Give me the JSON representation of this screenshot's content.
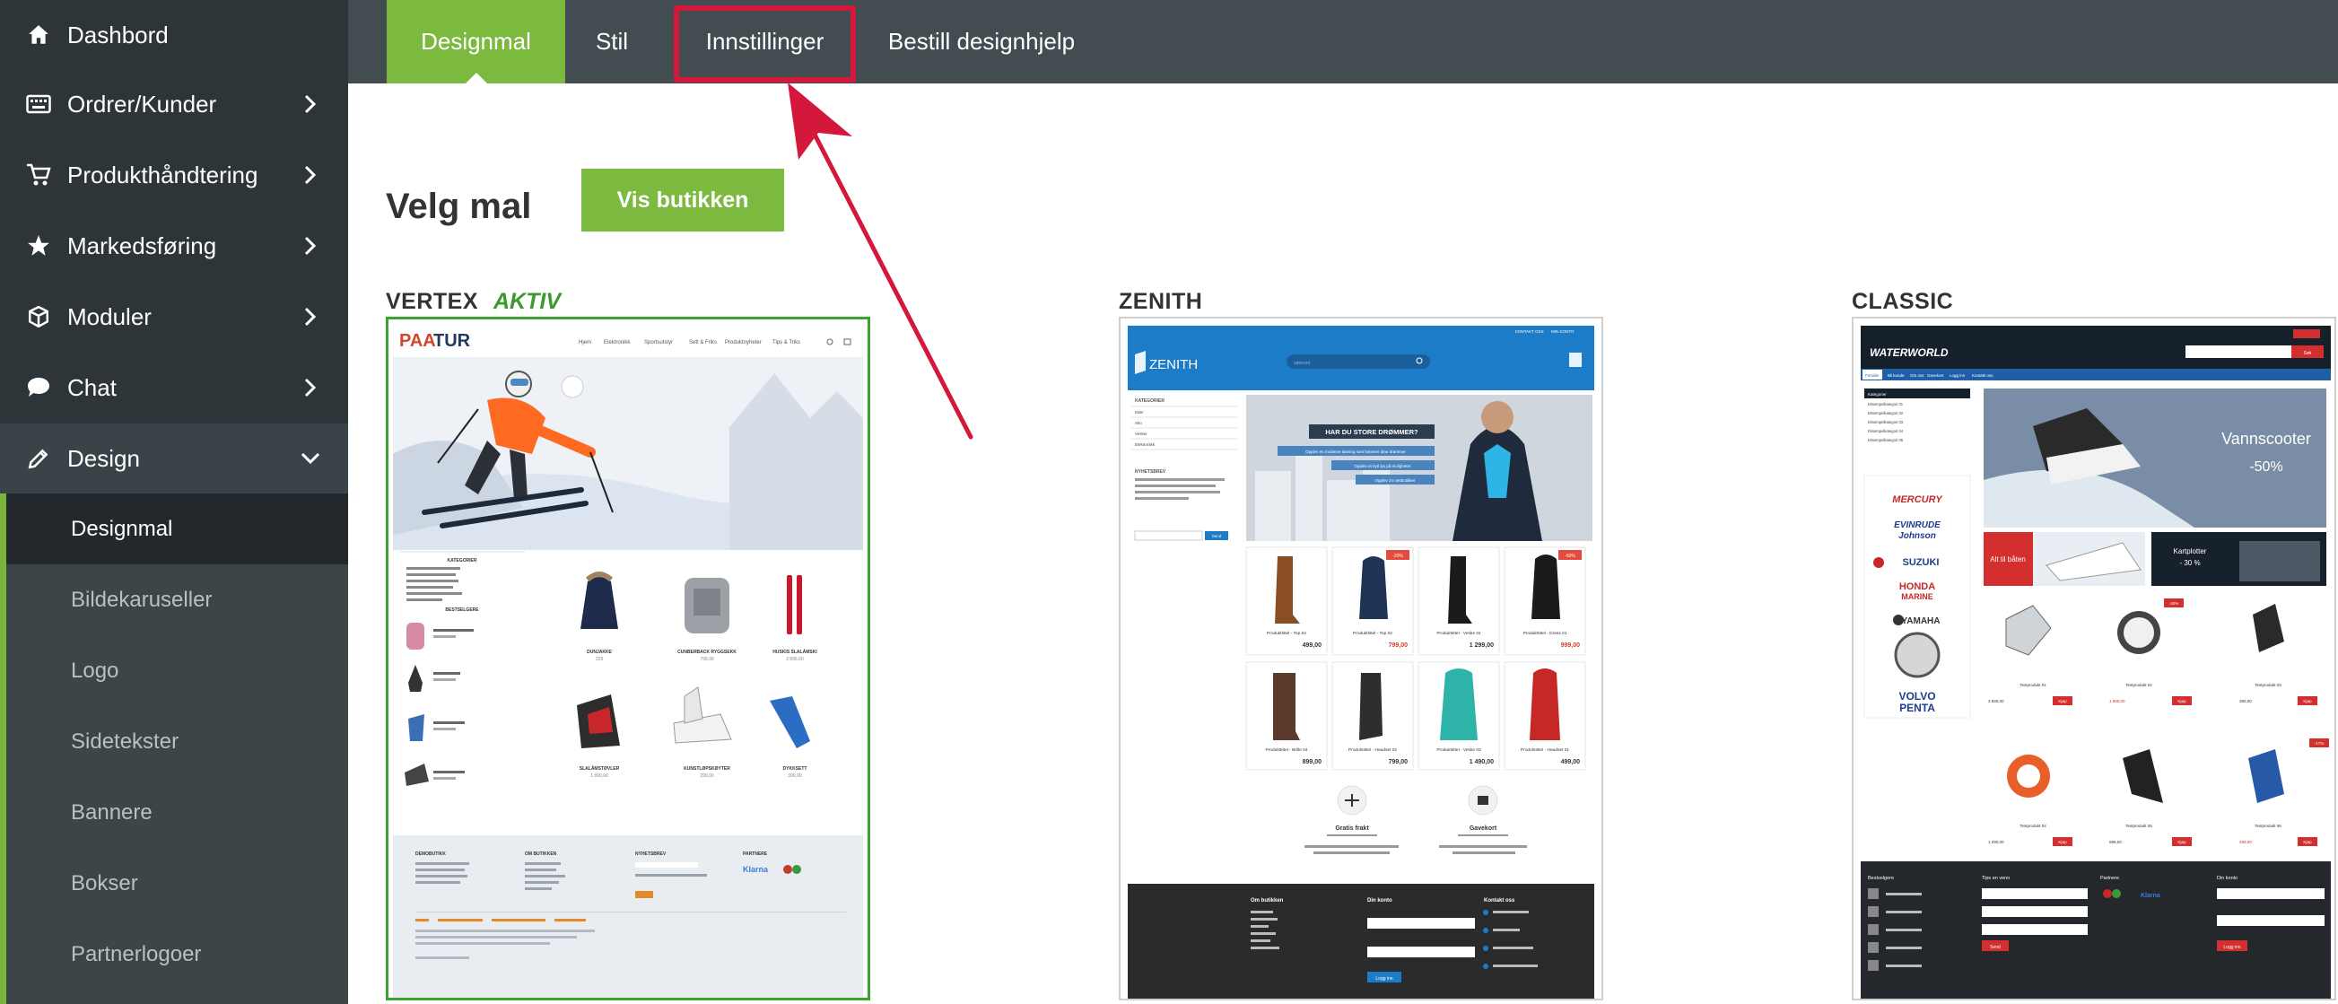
{
  "sidebar": {
    "items": [
      {
        "label": "Dashbord",
        "icon": "home-icon"
      },
      {
        "label": "Ordrer/Kunder",
        "icon": "keyboard-icon"
      },
      {
        "label": "Produkthåndtering",
        "icon": "cart-icon"
      },
      {
        "label": "Markedsføring",
        "icon": "star-icon"
      },
      {
        "label": "Moduler",
        "icon": "cube-icon"
      },
      {
        "label": "Chat",
        "icon": "chat-bubble-icon"
      },
      {
        "label": "Design",
        "icon": "pencil-icon"
      }
    ],
    "design_submenu": [
      "Designmal",
      "Bildekaruseller",
      "Logo",
      "Sidetekster",
      "Bannere",
      "Bokser",
      "Partnerlogoer"
    ]
  },
  "tabs": [
    {
      "label": "Designmal"
    },
    {
      "label": "Stil"
    },
    {
      "label": "Innstillinger"
    },
    {
      "label": "Bestill designhjelp"
    }
  ],
  "main": {
    "title": "Velg mal",
    "view_shop_label": "Vis butikken",
    "active_label": "AKTIV"
  },
  "templates": [
    {
      "name": "VERTEX",
      "preview": {
        "logo_a": "PAA",
        "logo_b": "TUR",
        "nav": [
          "Hjem",
          "Elektronikk",
          "Sportsutstyr",
          "Sett & Friks",
          "Produktnyheter",
          "Tips & Triks"
        ],
        "categories_title": "KATEGORIER",
        "bestsellers_title": "BESTSELGERE",
        "products": [
          "DUNJAKKE",
          "CUNBERBACK RYGGSEKK",
          "HUSKIS SLALÅMSKI",
          "SLALÅMSTØVLER",
          "KUNSTLØPSKØYTER",
          "DYKKSETT"
        ],
        "prices": [
          "329",
          "799,00",
          "2 895,00",
          "1 899,00",
          "299,00",
          "399,00"
        ],
        "footer": [
          "DEMOBUTIKK",
          "OM BUTIKKEN",
          "NYHETSBREV",
          "PARTNERE"
        ],
        "partner": "Klarna"
      }
    },
    {
      "name": "ZENITH",
      "preview": {
        "logo": "ZENITH",
        "search_placeholder": "søkeord",
        "top_links": [
          "KONTAKT OSS",
          "MIN KONTO"
        ],
        "sidebar_title": "KATEGORIER",
        "sidebar_items": [
          "Klær",
          "Sko",
          "Vesker",
          "Elektronikk"
        ],
        "newsletter_title": "NYHETSBREV",
        "newsletter_button": "Send",
        "hero_title": "HAR DU STORE DRØMMER?",
        "hero_lines": [
          "Opplev en moderne løsning som lanserer dine drømmer",
          "Opplev et nytt lys på muligheter",
          "Opplev 24 nettbutikker"
        ],
        "products": [
          "Produkttittel - Top 04",
          "Produkttittel - Top 02",
          "Produkttittel - Veske 04",
          "Produkttittel - Dress 01",
          "Produkttittel - Brille 04",
          "Produkttittel - Headset 02",
          "Produkttittel - Veske 03",
          "Produkttittel - Headset 01"
        ],
        "prices": [
          "499,00",
          "799,00",
          "1 299,00",
          "999,00",
          "899,00",
          "799,00",
          "1 490,00",
          "499,00"
        ],
        "badges": [
          "-20%",
          "-50%"
        ],
        "features": [
          "Gratis frakt",
          "Gavekort"
        ],
        "footer": [
          "Om butikken",
          "Din konto",
          "Kontakt oss"
        ],
        "login_button": "Logg inn"
      }
    },
    {
      "name": "CLASSIC",
      "preview": {
        "logo": "WATERWORLD",
        "search_button": "Søk",
        "nav": [
          "Forside",
          "Bli kunde",
          "Om oss",
          "Gavekort",
          "Logg inn",
          "Kontakt oss"
        ],
        "categories": [
          "Kategorier",
          "Eksempelkategori 01",
          "Eksempelkategori 02",
          "Eksempelkategori 03",
          "Eksempelkategori 04",
          "Eksempelkategori 05"
        ],
        "brands": [
          "MERCURY",
          "EVINRUDE",
          "Johnson",
          "SUZUKI",
          "HONDA",
          "MARINE",
          "YAMAHA",
          "VOLVO",
          "PENTA"
        ],
        "hero_title": "Vannscooter",
        "hero_discount": "-50%",
        "banner_1": "Alt til båten",
        "banner_2_line1": "Kartplotter",
        "banner_2_line2": "- 30 %",
        "products": [
          "Testprodukt 01",
          "Testprodukt 02",
          "Testprodukt 03",
          "Testprodukt 04",
          "Testprodukt 05",
          "Testprodukt 06"
        ],
        "prices": [
          "3 590,00",
          "1 990,00",
          "390,00",
          "1 290,00",
          "999,00",
          "490,00"
        ],
        "buy_label": "Kjøp",
        "badges": [
          "-20%",
          "-17%"
        ],
        "footer": [
          "Bestselgere",
          "Tips en venn",
          "Partnere",
          "Din konto"
        ],
        "footer_buttons": [
          "Send",
          "Logg inn"
        ]
      }
    }
  ],
  "colors": {
    "accent_green": "#7cb93f",
    "highlight_red": "#d4183c",
    "sidebar_bg": "#2e3538",
    "topbar_bg": "#434c51"
  }
}
